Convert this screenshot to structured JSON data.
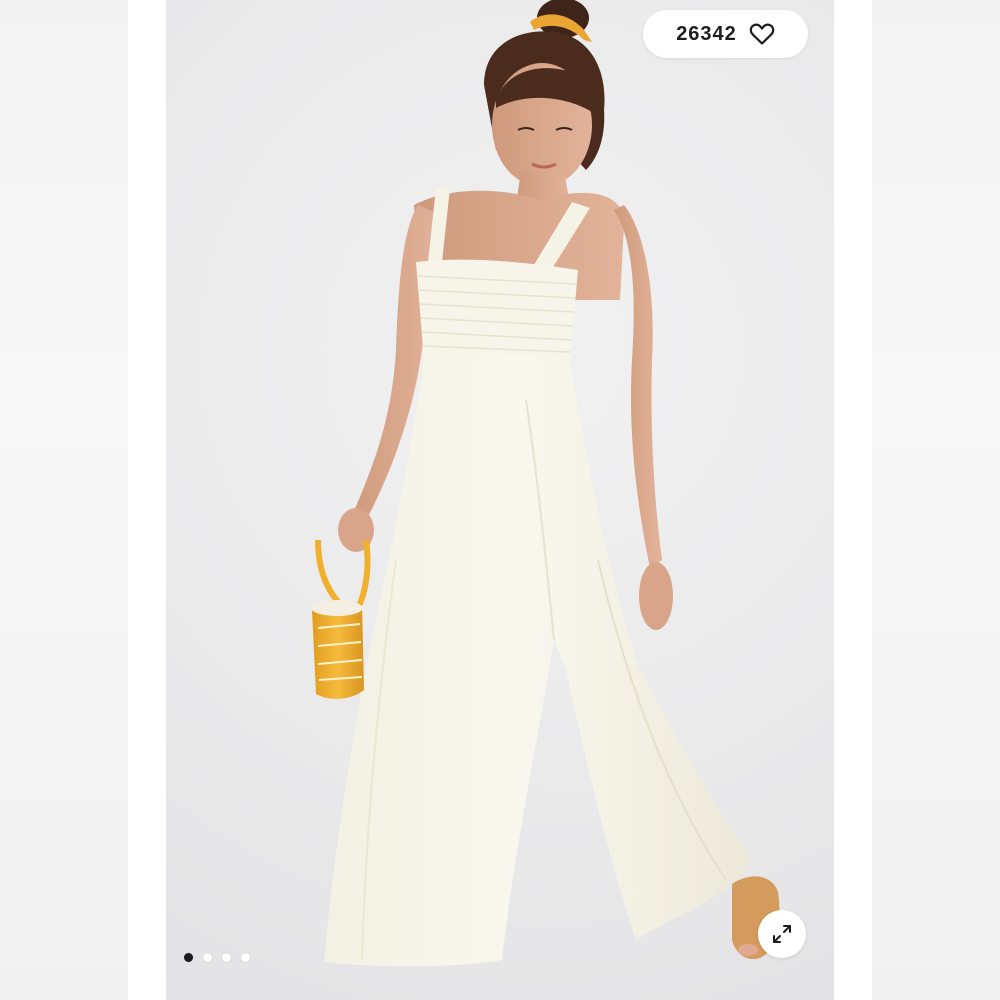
{
  "listing_photo": {
    "likes": {
      "count": "26342",
      "icon": "heart-outline-icon"
    },
    "expand": {
      "icon": "expand-diagonal-icon"
    },
    "carousel": {
      "total_photos": 4,
      "active_index": 0
    }
  },
  "colors": {
    "background": "#e9e9ea",
    "garment": "#f7f5ea",
    "skin": "#d8a58a",
    "hair": "#4a2b1e",
    "bag": "#f0b02e",
    "indicator_active": "#1b1b1b",
    "indicator_inactive": "#ffffff"
  }
}
